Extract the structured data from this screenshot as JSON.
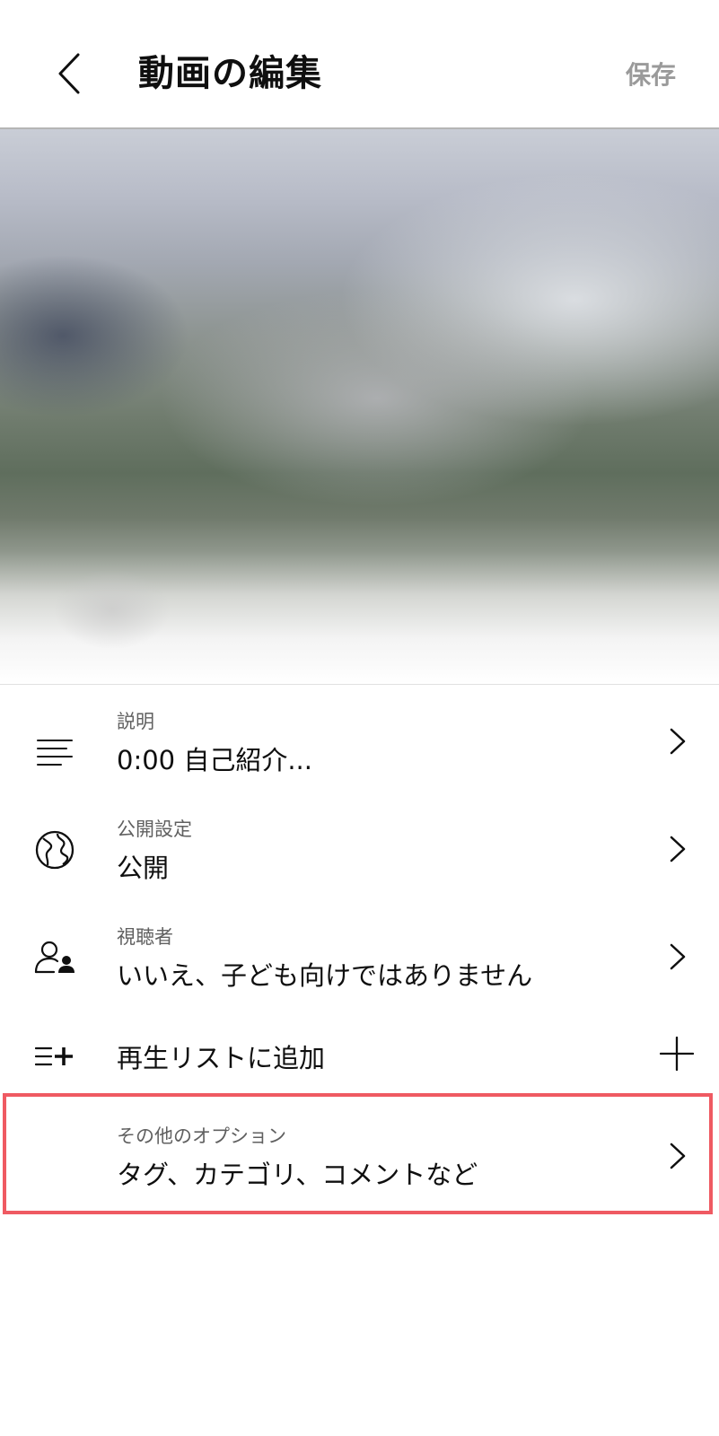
{
  "header": {
    "back_icon": "chevron-left-icon",
    "title": "動画の編集",
    "save_label": "保存"
  },
  "settings": [
    {
      "icon": "text-lines-icon",
      "label": "説明",
      "value": "0:00 自己紹介...",
      "action_icon": "chevron-right-icon"
    },
    {
      "icon": "globe-icon",
      "label": "公開設定",
      "value": "公開",
      "action_icon": "chevron-right-icon"
    },
    {
      "icon": "audience-icon",
      "label": "視聴者",
      "value": "いいえ、子ども向けではありません",
      "action_icon": "chevron-right-icon"
    },
    {
      "icon": "playlist-add-icon",
      "label": "",
      "value": "再生リストに追加",
      "action_icon": "plus-icon"
    },
    {
      "icon": "",
      "label": "その他のオプション",
      "value": "タグ、カテゴリ、コメントなど",
      "action_icon": "chevron-right-icon",
      "highlighted": true,
      "highlight_color": "#ef5a62"
    }
  ],
  "colors": {
    "text_primary": "#0f0f0f",
    "text_secondary": "#606060",
    "save_disabled": "#9a9a9a",
    "highlight": "#ef5a62"
  }
}
